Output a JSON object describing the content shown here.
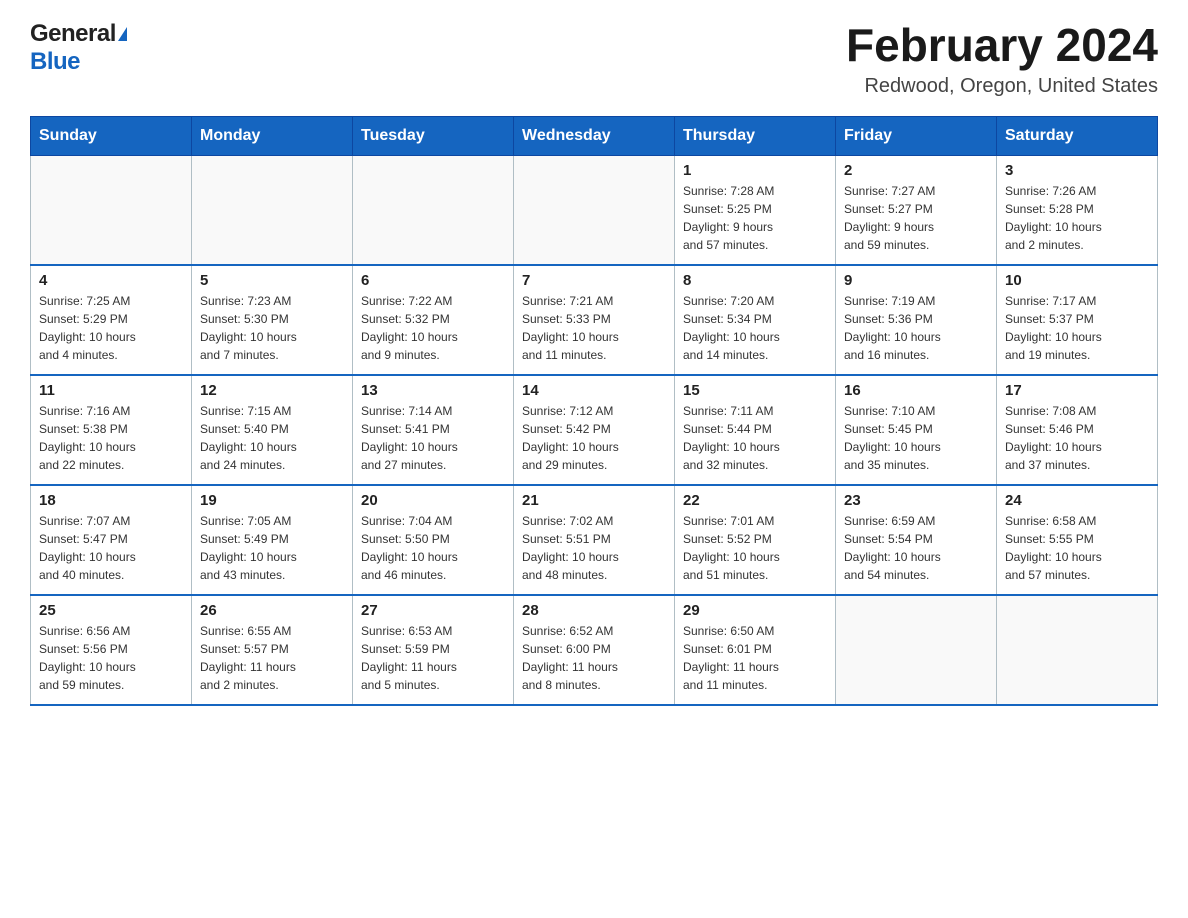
{
  "header": {
    "logo_general": "General",
    "logo_blue": "Blue",
    "month_title": "February 2024",
    "location": "Redwood, Oregon, United States"
  },
  "days_of_week": [
    "Sunday",
    "Monday",
    "Tuesday",
    "Wednesday",
    "Thursday",
    "Friday",
    "Saturday"
  ],
  "weeks": [
    [
      {
        "day": "",
        "info": ""
      },
      {
        "day": "",
        "info": ""
      },
      {
        "day": "",
        "info": ""
      },
      {
        "day": "",
        "info": ""
      },
      {
        "day": "1",
        "info": "Sunrise: 7:28 AM\nSunset: 5:25 PM\nDaylight: 9 hours\nand 57 minutes."
      },
      {
        "day": "2",
        "info": "Sunrise: 7:27 AM\nSunset: 5:27 PM\nDaylight: 9 hours\nand 59 minutes."
      },
      {
        "day": "3",
        "info": "Sunrise: 7:26 AM\nSunset: 5:28 PM\nDaylight: 10 hours\nand 2 minutes."
      }
    ],
    [
      {
        "day": "4",
        "info": "Sunrise: 7:25 AM\nSunset: 5:29 PM\nDaylight: 10 hours\nand 4 minutes."
      },
      {
        "day": "5",
        "info": "Sunrise: 7:23 AM\nSunset: 5:30 PM\nDaylight: 10 hours\nand 7 minutes."
      },
      {
        "day": "6",
        "info": "Sunrise: 7:22 AM\nSunset: 5:32 PM\nDaylight: 10 hours\nand 9 minutes."
      },
      {
        "day": "7",
        "info": "Sunrise: 7:21 AM\nSunset: 5:33 PM\nDaylight: 10 hours\nand 11 minutes."
      },
      {
        "day": "8",
        "info": "Sunrise: 7:20 AM\nSunset: 5:34 PM\nDaylight: 10 hours\nand 14 minutes."
      },
      {
        "day": "9",
        "info": "Sunrise: 7:19 AM\nSunset: 5:36 PM\nDaylight: 10 hours\nand 16 minutes."
      },
      {
        "day": "10",
        "info": "Sunrise: 7:17 AM\nSunset: 5:37 PM\nDaylight: 10 hours\nand 19 minutes."
      }
    ],
    [
      {
        "day": "11",
        "info": "Sunrise: 7:16 AM\nSunset: 5:38 PM\nDaylight: 10 hours\nand 22 minutes."
      },
      {
        "day": "12",
        "info": "Sunrise: 7:15 AM\nSunset: 5:40 PM\nDaylight: 10 hours\nand 24 minutes."
      },
      {
        "day": "13",
        "info": "Sunrise: 7:14 AM\nSunset: 5:41 PM\nDaylight: 10 hours\nand 27 minutes."
      },
      {
        "day": "14",
        "info": "Sunrise: 7:12 AM\nSunset: 5:42 PM\nDaylight: 10 hours\nand 29 minutes."
      },
      {
        "day": "15",
        "info": "Sunrise: 7:11 AM\nSunset: 5:44 PM\nDaylight: 10 hours\nand 32 minutes."
      },
      {
        "day": "16",
        "info": "Sunrise: 7:10 AM\nSunset: 5:45 PM\nDaylight: 10 hours\nand 35 minutes."
      },
      {
        "day": "17",
        "info": "Sunrise: 7:08 AM\nSunset: 5:46 PM\nDaylight: 10 hours\nand 37 minutes."
      }
    ],
    [
      {
        "day": "18",
        "info": "Sunrise: 7:07 AM\nSunset: 5:47 PM\nDaylight: 10 hours\nand 40 minutes."
      },
      {
        "day": "19",
        "info": "Sunrise: 7:05 AM\nSunset: 5:49 PM\nDaylight: 10 hours\nand 43 minutes."
      },
      {
        "day": "20",
        "info": "Sunrise: 7:04 AM\nSunset: 5:50 PM\nDaylight: 10 hours\nand 46 minutes."
      },
      {
        "day": "21",
        "info": "Sunrise: 7:02 AM\nSunset: 5:51 PM\nDaylight: 10 hours\nand 48 minutes."
      },
      {
        "day": "22",
        "info": "Sunrise: 7:01 AM\nSunset: 5:52 PM\nDaylight: 10 hours\nand 51 minutes."
      },
      {
        "day": "23",
        "info": "Sunrise: 6:59 AM\nSunset: 5:54 PM\nDaylight: 10 hours\nand 54 minutes."
      },
      {
        "day": "24",
        "info": "Sunrise: 6:58 AM\nSunset: 5:55 PM\nDaylight: 10 hours\nand 57 minutes."
      }
    ],
    [
      {
        "day": "25",
        "info": "Sunrise: 6:56 AM\nSunset: 5:56 PM\nDaylight: 10 hours\nand 59 minutes."
      },
      {
        "day": "26",
        "info": "Sunrise: 6:55 AM\nSunset: 5:57 PM\nDaylight: 11 hours\nand 2 minutes."
      },
      {
        "day": "27",
        "info": "Sunrise: 6:53 AM\nSunset: 5:59 PM\nDaylight: 11 hours\nand 5 minutes."
      },
      {
        "day": "28",
        "info": "Sunrise: 6:52 AM\nSunset: 6:00 PM\nDaylight: 11 hours\nand 8 minutes."
      },
      {
        "day": "29",
        "info": "Sunrise: 6:50 AM\nSunset: 6:01 PM\nDaylight: 11 hours\nand 11 minutes."
      },
      {
        "day": "",
        "info": ""
      },
      {
        "day": "",
        "info": ""
      }
    ]
  ]
}
